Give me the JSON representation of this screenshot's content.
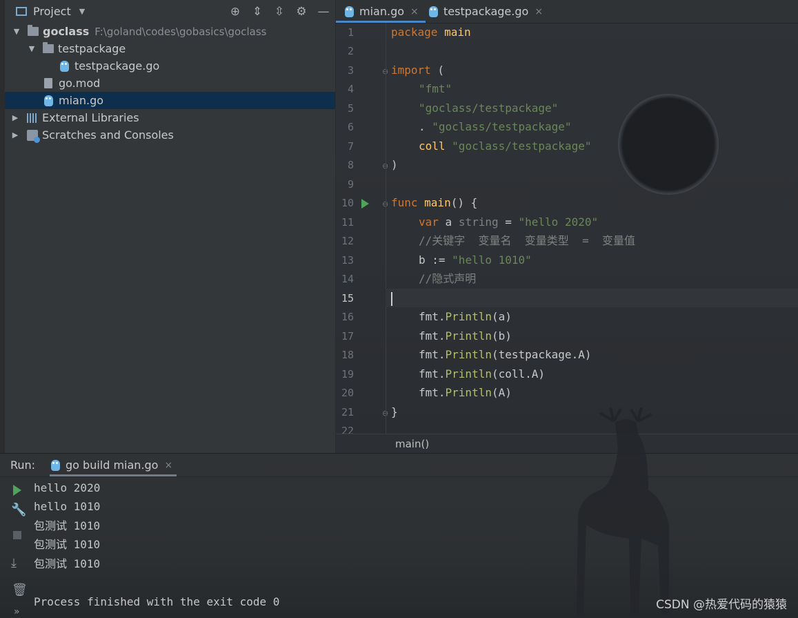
{
  "project_panel": {
    "title": "Project",
    "tree": [
      {
        "label": "goclass",
        "hint": "F:\\goland\\codes\\gobasics\\goclass"
      },
      {
        "label": "testpackage"
      },
      {
        "label": "testpackage.go"
      },
      {
        "label": "go.mod"
      },
      {
        "label": "mian.go"
      },
      {
        "label": "External Libraries"
      },
      {
        "label": "Scratches and Consoles"
      }
    ]
  },
  "editor": {
    "tabs": [
      {
        "label": "mian.go",
        "close": "×"
      },
      {
        "label": "testpackage.go",
        "close": "×"
      }
    ],
    "line_numbers": [
      "1",
      "2",
      "3",
      "4",
      "5",
      "6",
      "7",
      "8",
      "9",
      "10",
      "11",
      "12",
      "13",
      "14",
      "15",
      "16",
      "17",
      "18",
      "19",
      "20",
      "21",
      "22"
    ],
    "current_line": 15,
    "code": {
      "l1a": "package",
      "l1b": " main",
      "l3a": "import",
      "l3b": " (",
      "l4": "\"fmt\"",
      "l5": "\"goclass/testpackage\"",
      "l6a": ". ",
      "l6b": "\"goclass/testpackage\"",
      "l7a": "coll ",
      "l7b": "\"goclass/testpackage\"",
      "l8": ")",
      "l10a": "func",
      "l10b": " main",
      "l10c": "() {",
      "l11a": "var",
      "l11b": " a ",
      "l11c": "string",
      "l11d": " = ",
      "l11e": "\"hello 2020\"",
      "l12": "//关键字  变量名  变量类型  =  变量值",
      "l13a": "b := ",
      "l13b": "\"hello 1010\"",
      "l14": "//隐式声明",
      "l16a": "fmt.",
      "l16b": "Println",
      "l16c": "(a)",
      "l17a": "fmt.",
      "l17b": "Println",
      "l17c": "(b)",
      "l18a": "fmt.",
      "l18b": "Println",
      "l18c": "(testpackage.A)",
      "l19a": "fmt.",
      "l19b": "Println",
      "l19c": "(coll.A)",
      "l20a": "fmt.",
      "l20b": "Println",
      "l20c": "(A)",
      "l21": "}"
    },
    "breadcrumb": "main()"
  },
  "run_panel": {
    "label": "Run:",
    "tab_label": "go build mian.go",
    "tab_close": "×",
    "output": [
      "hello 2020",
      "hello 1010",
      "包测试 1010",
      "包测试 1010",
      "包测试 1010",
      "",
      "Process finished with the exit code 0"
    ]
  },
  "watermark": "CSDN @热爱代码的猿猿",
  "colors": {
    "keyword": "#cc7832",
    "string": "#6a8759",
    "function": "#ffc66d",
    "comment": "#808080",
    "selection": "#0d2f4d",
    "run_green": "#4fa35b"
  },
  "icons": [
    "project-view-icon",
    "locate-icon",
    "expand-all-icon",
    "collapse-all-icon",
    "gear-icon",
    "minimize-icon",
    "folder-icon",
    "go-file-icon",
    "mod-file-icon",
    "libraries-icon",
    "scratches-icon",
    "run-icon",
    "wrench-icon",
    "stop-icon",
    "scroll-to-end-icon",
    "trash-icon"
  ]
}
